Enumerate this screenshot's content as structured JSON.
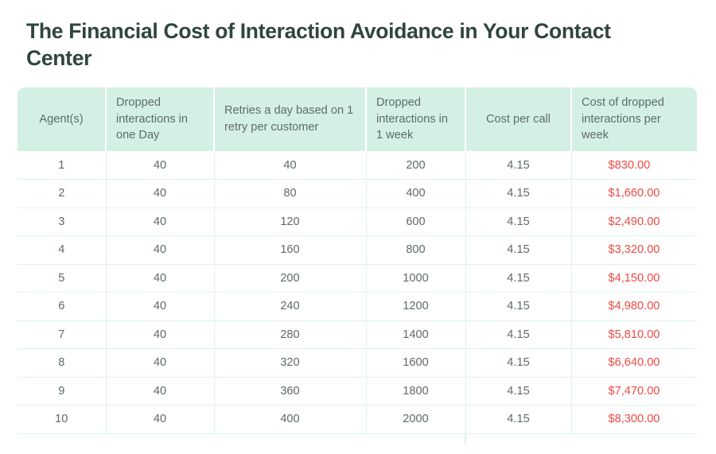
{
  "title": "The Financial Cost of Interaction Avoidance in Your Contact Center",
  "colors": {
    "header_bg": "#d4f0e4",
    "header_text": "#5e6b68",
    "title_text": "#2f4540",
    "body_text": "#5e6b68",
    "cost_text": "#ef4a44",
    "row_divider": "#dff3ea",
    "page_bg": "#ffffff"
  },
  "table": {
    "columns": [
      {
        "label": "Agent(s)",
        "align": "center"
      },
      {
        "label": "Dropped interactions in one Day",
        "align": "left"
      },
      {
        "label": "Retries a day based on 1 retry per customer",
        "align": "left"
      },
      {
        "label": "Dropped interactions in 1 week",
        "align": "left"
      },
      {
        "label": "Cost per call",
        "align": "center"
      },
      {
        "label": "Cost of dropped interactions per week",
        "align": "left"
      }
    ],
    "rows": [
      {
        "agents": "1",
        "dropped_day": "40",
        "retries_day": "40",
        "dropped_week": "200",
        "cost_per_call": "4.15",
        "cost_week": "$830.00"
      },
      {
        "agents": "2",
        "dropped_day": "40",
        "retries_day": "80",
        "dropped_week": "400",
        "cost_per_call": "4.15",
        "cost_week": "$1,660.00"
      },
      {
        "agents": "3",
        "dropped_day": "40",
        "retries_day": "120",
        "dropped_week": "600",
        "cost_per_call": "4.15",
        "cost_week": "$2,490.00"
      },
      {
        "agents": "4",
        "dropped_day": "40",
        "retries_day": "160",
        "dropped_week": "800",
        "cost_per_call": "4.15",
        "cost_week": "$3,320.00"
      },
      {
        "agents": "5",
        "dropped_day": "40",
        "retries_day": "200",
        "dropped_week": "1000",
        "cost_per_call": "4.15",
        "cost_week": "$4,150.00"
      },
      {
        "agents": "6",
        "dropped_day": "40",
        "retries_day": "240",
        "dropped_week": "1200",
        "cost_per_call": "4.15",
        "cost_week": "$4,980.00"
      },
      {
        "agents": "7",
        "dropped_day": "40",
        "retries_day": "280",
        "dropped_week": "1400",
        "cost_per_call": "4.15",
        "cost_week": "$5,810.00"
      },
      {
        "agents": "8",
        "dropped_day": "40",
        "retries_day": "320",
        "dropped_week": "1600",
        "cost_per_call": "4.15",
        "cost_week": "$6,640.00"
      },
      {
        "agents": "9",
        "dropped_day": "40",
        "retries_day": "360",
        "dropped_week": "1800",
        "cost_per_call": "4.15",
        "cost_week": "$7,470.00"
      },
      {
        "agents": "10",
        "dropped_day": "40",
        "retries_day": "400",
        "dropped_week": "2000",
        "cost_per_call": "4.15",
        "cost_week": "$8,300.00"
      }
    ]
  },
  "chart_data": {
    "type": "table",
    "title": "The Financial Cost of Interaction Avoidance in Your Contact Center",
    "columns": [
      "Agent(s)",
      "Dropped interactions in one Day",
      "Retries a day based on 1 retry per customer",
      "Dropped interactions in 1 week",
      "Cost per call",
      "Cost of dropped interactions per week"
    ],
    "rows": [
      [
        "1",
        "40",
        "40",
        "200",
        "4.15",
        "$830.00"
      ],
      [
        "2",
        "40",
        "80",
        "400",
        "4.15",
        "$1,660.00"
      ],
      [
        "3",
        "40",
        "120",
        "600",
        "4.15",
        "$2,490.00"
      ],
      [
        "4",
        "40",
        "160",
        "800",
        "4.15",
        "$3,320.00"
      ],
      [
        "5",
        "40",
        "200",
        "1000",
        "4.15",
        "$4,150.00"
      ],
      [
        "6",
        "40",
        "240",
        "1200",
        "4.15",
        "$4,980.00"
      ],
      [
        "7",
        "40",
        "280",
        "1400",
        "4.15",
        "$5,810.00"
      ],
      [
        "8",
        "40",
        "320",
        "1600",
        "4.15",
        "$6,640.00"
      ],
      [
        "9",
        "40",
        "360",
        "1800",
        "4.15",
        "$7,470.00"
      ],
      [
        "10",
        "40",
        "400",
        "2000",
        "4.15",
        "$8,300.00"
      ]
    ],
    "series": [
      {
        "name": "Agent(s)",
        "values": [
          1,
          2,
          3,
          4,
          5,
          6,
          7,
          8,
          9,
          10
        ]
      },
      {
        "name": "Dropped interactions in one Day",
        "values": [
          40,
          40,
          40,
          40,
          40,
          40,
          40,
          40,
          40,
          40
        ]
      },
      {
        "name": "Retries a day based on 1 retry per customer",
        "values": [
          40,
          80,
          120,
          160,
          200,
          240,
          280,
          320,
          360,
          400
        ]
      },
      {
        "name": "Dropped interactions in 1 week",
        "values": [
          200,
          400,
          600,
          800,
          1000,
          1200,
          1400,
          1600,
          1800,
          2000
        ]
      },
      {
        "name": "Cost per call",
        "values": [
          4.15,
          4.15,
          4.15,
          4.15,
          4.15,
          4.15,
          4.15,
          4.15,
          4.15,
          4.15
        ]
      },
      {
        "name": "Cost of dropped interactions per week",
        "values": [
          830,
          1660,
          2490,
          3320,
          4150,
          4980,
          5810,
          6640,
          7470,
          8300
        ]
      }
    ]
  }
}
